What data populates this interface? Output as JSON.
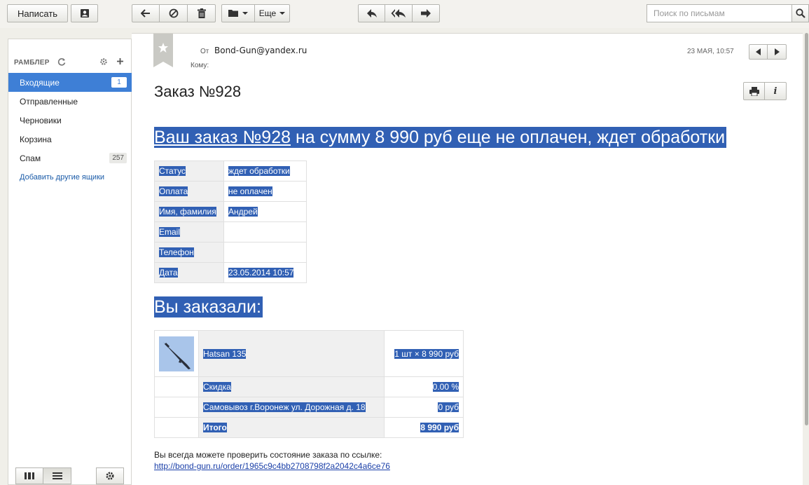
{
  "toolbar": {
    "compose_label": "Написать",
    "more_label": "Еще",
    "search_placeholder": "Поиск по письмам"
  },
  "sidebar": {
    "account_label": "РАМБЛЕР",
    "folders": [
      {
        "label": "Входящие",
        "count": "1",
        "active": true
      },
      {
        "label": "Отправленные",
        "count": ""
      },
      {
        "label": "Черновики",
        "count": ""
      },
      {
        "label": "Корзина",
        "count": ""
      },
      {
        "label": "Спам",
        "count": "257"
      }
    ],
    "add_mailboxes_label": "Добавить другие ящики"
  },
  "message": {
    "from_label": "От",
    "from_value": "Bond-Gun@yandex.ru",
    "to_label": "Кому:",
    "date": "23 МАЯ, 10:57",
    "subject": "Заказ №928",
    "heading_link": "Ваш заказ №928",
    "heading_rest": " на сумму 8 990 руб еще не оплачен, ждет обработки",
    "info_rows": [
      {
        "key": "Статус",
        "value": "ждет обработки"
      },
      {
        "key": "Оплата",
        "value": "не оплачен"
      },
      {
        "key": "Имя, фамилия",
        "value": "Андрей"
      },
      {
        "key": "Email",
        "value": ""
      },
      {
        "key": "Телефон",
        "value": ""
      },
      {
        "key": "Дата",
        "value": "23.05.2014 10:57"
      }
    ],
    "ordered_heading": "Вы заказали:",
    "order_rows": [
      {
        "name": "Hatsan 135",
        "amount": "1 шт × 8 990 руб"
      },
      {
        "name": "Скидка",
        "amount": "0.00 %"
      },
      {
        "name": "Самовывоз г.Воронеж ул. Дорожная д. 18",
        "amount": "0 руб"
      },
      {
        "name": "Итого",
        "amount": "8 990 руб"
      }
    ],
    "footer_text": "Вы всегда можете проверить состояние заказа по ссылке:",
    "footer_link": "http://bond-gun.ru/order/1965c9c4bb2708798f2a2042c4a6ce76"
  },
  "colors": {
    "selection": "#3160b4",
    "active_folder": "#3e7fd6",
    "link": "#1a3fa8"
  }
}
